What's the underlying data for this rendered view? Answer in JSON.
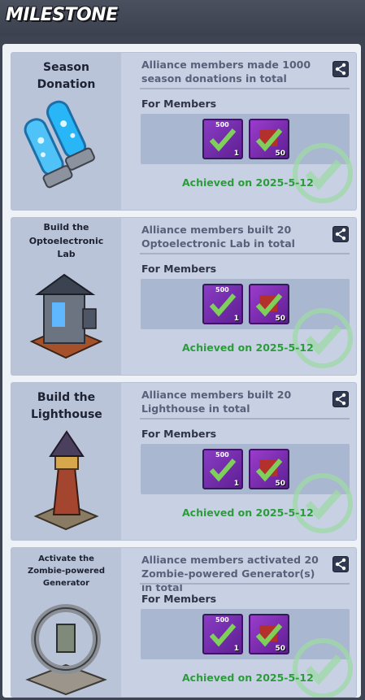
{
  "header": {
    "title": "MILESTONE"
  },
  "cards": [
    {
      "title": "Season Donation",
      "description": "Alliance members made 1000 season donations in total",
      "for_label": "For Members",
      "reward1": {
        "tag": "500",
        "qty": "1"
      },
      "reward2": {
        "qty": "50"
      },
      "achieved": "Achieved on 2025-5-12",
      "icon": "plasma-capsule-icon"
    },
    {
      "title": "Build the Optoelectronic Lab",
      "description": "Alliance members built 20 Optoelectronic Lab in total",
      "for_label": "For Members",
      "reward1": {
        "tag": "500",
        "qty": "1"
      },
      "reward2": {
        "qty": "50"
      },
      "achieved": "Achieved on 2025-5-12",
      "icon": "optoelectronic-lab-icon"
    },
    {
      "title": "Build the Lighthouse",
      "description": "Alliance members built 20 Lighthouse in total",
      "for_label": "For Members",
      "reward1": {
        "tag": "500",
        "qty": "1"
      },
      "reward2": {
        "qty": "50"
      },
      "achieved": "Achieved on 2025-5-12",
      "icon": "lighthouse-icon"
    },
    {
      "title": "Activate the Zombie-powered Generator",
      "description": "Alliance members activated 20 Zombie-powered Generator(s) in total",
      "for_label": "For Members",
      "reward1": {
        "tag": "500",
        "qty": "1"
      },
      "reward2": {
        "qty": "50"
      },
      "achieved": "Achieved on 2025-5-12",
      "icon": "zombie-generator-icon"
    }
  ],
  "colors": {
    "achieved": "#2a9d3a",
    "reward_bg": "#7a2fb3",
    "check": "#7fd05a"
  }
}
